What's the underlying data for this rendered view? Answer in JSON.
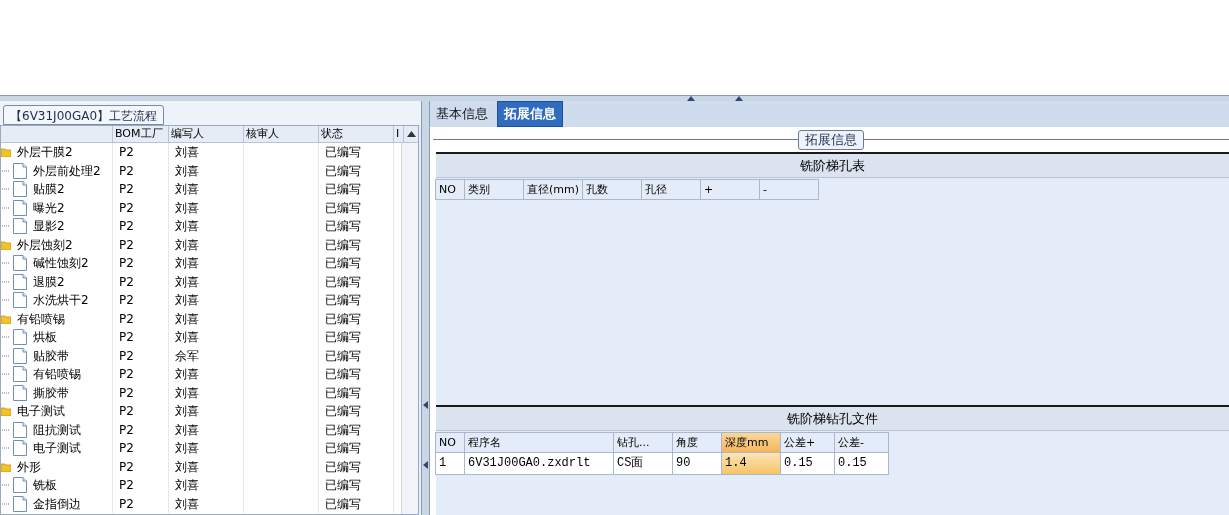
{
  "left_panel": {
    "title": "【6V31J00GA0】工艺流程",
    "columns": [
      "BOM工厂",
      "编写人",
      "核审人",
      "状态",
      "I"
    ],
    "tree": [
      {
        "kind": "folder",
        "label": "外层干膜2",
        "factory": "P2",
        "author": "刘喜",
        "status": "已编写",
        "children": [
          {
            "kind": "file",
            "label": "外层前处理2",
            "factory": "P2",
            "author": "刘喜",
            "status": "已编写"
          },
          {
            "kind": "file",
            "label": "贴膜2",
            "factory": "P2",
            "author": "刘喜",
            "status": "已编写"
          },
          {
            "kind": "file",
            "label": "曝光2",
            "factory": "P2",
            "author": "刘喜",
            "status": "已编写"
          },
          {
            "kind": "file",
            "label": "显影2",
            "factory": "P2",
            "author": "刘喜",
            "status": "已编写"
          }
        ]
      },
      {
        "kind": "folder",
        "label": "外层蚀刻2",
        "factory": "P2",
        "author": "刘喜",
        "status": "已编写",
        "children": [
          {
            "kind": "file",
            "label": "碱性蚀刻2",
            "factory": "P2",
            "author": "刘喜",
            "status": "已编写"
          },
          {
            "kind": "file",
            "label": "退膜2",
            "factory": "P2",
            "author": "刘喜",
            "status": "已编写"
          },
          {
            "kind": "file",
            "label": "水洗烘干2",
            "factory": "P2",
            "author": "刘喜",
            "status": "已编写"
          }
        ]
      },
      {
        "kind": "folder",
        "label": "有铅喷锡",
        "factory": "P2",
        "author": "刘喜",
        "status": "已编写",
        "children": [
          {
            "kind": "file",
            "label": "烘板",
            "factory": "P2",
            "author": "刘喜",
            "status": "已编写"
          },
          {
            "kind": "file",
            "label": "贴胶带",
            "factory": "P2",
            "author": "佘军",
            "status": "已编写"
          },
          {
            "kind": "file",
            "label": "有铅喷锡",
            "factory": "P2",
            "author": "刘喜",
            "status": "已编写"
          },
          {
            "kind": "file",
            "label": "撕胶带",
            "factory": "P2",
            "author": "刘喜",
            "status": "已编写"
          }
        ]
      },
      {
        "kind": "folder",
        "label": "电子测试",
        "factory": "P2",
        "author": "刘喜",
        "status": "已编写",
        "children": [
          {
            "kind": "file",
            "label": "阻抗测试",
            "factory": "P2",
            "author": "刘喜",
            "status": "已编写"
          },
          {
            "kind": "file",
            "label": "电子测试",
            "factory": "P2",
            "author": "刘喜",
            "status": "已编写"
          }
        ]
      },
      {
        "kind": "folder",
        "label": "外形",
        "factory": "P2",
        "author": "刘喜",
        "status": "已编写",
        "children": [
          {
            "kind": "file",
            "label": "铣板",
            "factory": "P2",
            "author": "刘喜",
            "status": "已编写"
          },
          {
            "kind": "file",
            "label": "金指倒边",
            "factory": "P2",
            "author": "刘喜",
            "status": "已编写"
          }
        ]
      }
    ]
  },
  "right_panel": {
    "tabs": [
      {
        "label": "基本信息",
        "selected": false
      },
      {
        "label": "拓展信息",
        "selected": true
      }
    ],
    "group_title": "拓展信息",
    "sections": [
      {
        "title": "铣阶梯孔表",
        "columns": [
          {
            "label": "NO",
            "selected": false
          },
          {
            "label": "类别",
            "selected": false
          },
          {
            "label": "直径(mm)",
            "selected": false
          },
          {
            "label": "孔数",
            "selected": false
          },
          {
            "label": "孔径",
            "selected": false
          },
          {
            "label": "+",
            "selected": false
          },
          {
            "label": "-",
            "selected": false
          }
        ]
      },
      {
        "title": "铣阶梯钻孔文件",
        "columns": [
          {
            "label": "NO",
            "selected": false
          },
          {
            "label": "程序名",
            "selected": false
          },
          {
            "label": "钻孔...",
            "selected": false
          },
          {
            "label": "角度",
            "selected": false
          },
          {
            "label": "深度mm",
            "selected": true
          },
          {
            "label": "公差+",
            "selected": false
          },
          {
            "label": "公差-",
            "selected": false
          }
        ],
        "rows": [
          [
            "1",
            "6V31J00GA0.zxdrlt",
            "CS面",
            "90",
            "1.4",
            "0.15",
            "0.15"
          ]
        ]
      }
    ]
  }
}
